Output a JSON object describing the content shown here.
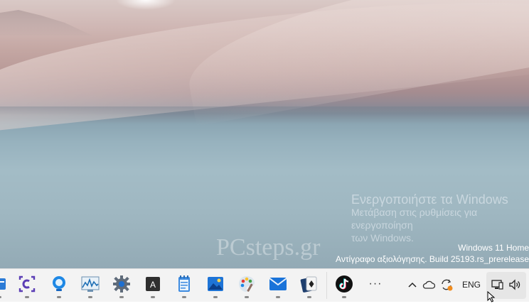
{
  "watermark": {
    "activate_title": "Ενεργοποιήστε τα Windows",
    "activate_line1": "Μετάβαση στις ρυθμίσεις για ενεργοποίηση",
    "activate_line2": "των Windows."
  },
  "build_info": {
    "line1": "Windows 11 Home",
    "line2": "Αντίγραφο αξιολόγησης. Build 25193.rs_prerelease"
  },
  "site_watermark": "PCsteps.gr",
  "taskbar": {
    "apps": [
      {
        "name": "file-explorer-icon"
      },
      {
        "name": "clipchamp-icon"
      },
      {
        "name": "cortana-icon"
      },
      {
        "name": "resource-monitor-icon"
      },
      {
        "name": "settings-gear-icon"
      },
      {
        "name": "terminal-app-icon"
      },
      {
        "name": "notepad-icon"
      },
      {
        "name": "photos-icon"
      },
      {
        "name": "paint-icon"
      },
      {
        "name": "mail-icon"
      },
      {
        "name": "solitaire-icon"
      },
      {
        "name": "tiktok-icon"
      }
    ],
    "more": "···"
  },
  "tray": {
    "language": "ENG"
  },
  "colors": {
    "taskbar_bg": "#f3f3f3",
    "accent_blue": "#0a64c8",
    "sync_orange": "#f08c1e"
  }
}
